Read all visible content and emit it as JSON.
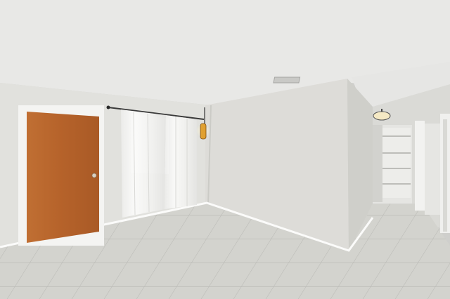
{
  "scene": {
    "subject": "empty-room-interior",
    "colors": {
      "ceiling": "#e9e9e7",
      "wall_left": "#e2e2de",
      "wall_right": "#dcdcd8",
      "floor": "#d4d4cf",
      "door": "#b7652c",
      "curtain": "#f2f2f0",
      "baseboard": "#ffffff"
    }
  }
}
